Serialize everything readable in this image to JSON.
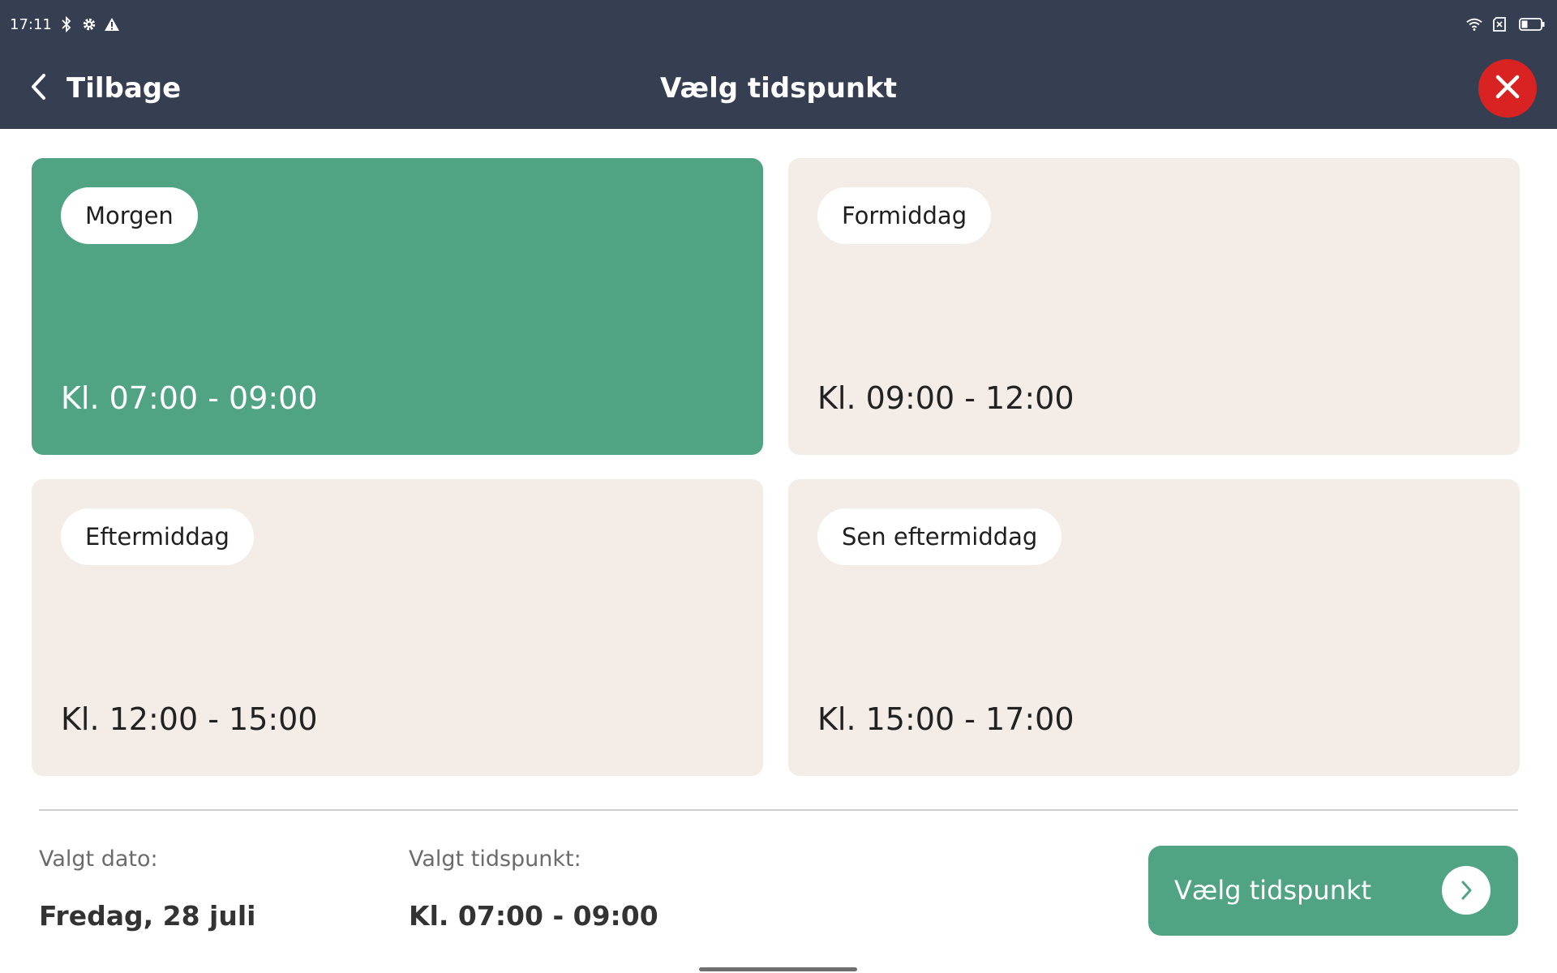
{
  "status_bar": {
    "time": "17:11",
    "left_icons": [
      "bluetooth-icon",
      "settings-gear-icon",
      "warning-icon"
    ],
    "right_icons": [
      "wifi-icon",
      "sim-card-icon",
      "battery-icon"
    ]
  },
  "header": {
    "back_label": "Tilbage",
    "title": "Vælg tidspunkt",
    "close_icon": "close-icon"
  },
  "slots": [
    {
      "name": "Morgen",
      "time": "Kl. 07:00 - 09:00",
      "selected": true
    },
    {
      "name": "Formiddag",
      "time": "Kl. 09:00 - 12:00",
      "selected": false
    },
    {
      "name": "Eftermiddag",
      "time": "Kl. 12:00 - 15:00",
      "selected": false
    },
    {
      "name": "Sen eftermiddag",
      "time": "Kl. 15:00 - 17:00",
      "selected": false
    }
  ],
  "summary": {
    "date_label": "Valgt dato:",
    "date_value": "Fredag, 28 juli",
    "time_label": "Valgt tidspunkt:",
    "time_value": "Kl. 07:00 - 09:00"
  },
  "confirm_button": {
    "label": "Vælg tidspunkt",
    "icon": "chevron-right-icon"
  },
  "colors": {
    "header_bg": "#363e51",
    "selected_slot": "#50a484",
    "unselected_slot": "#f3ece7",
    "close_button": "#d92323",
    "confirm_button": "#50a484"
  }
}
